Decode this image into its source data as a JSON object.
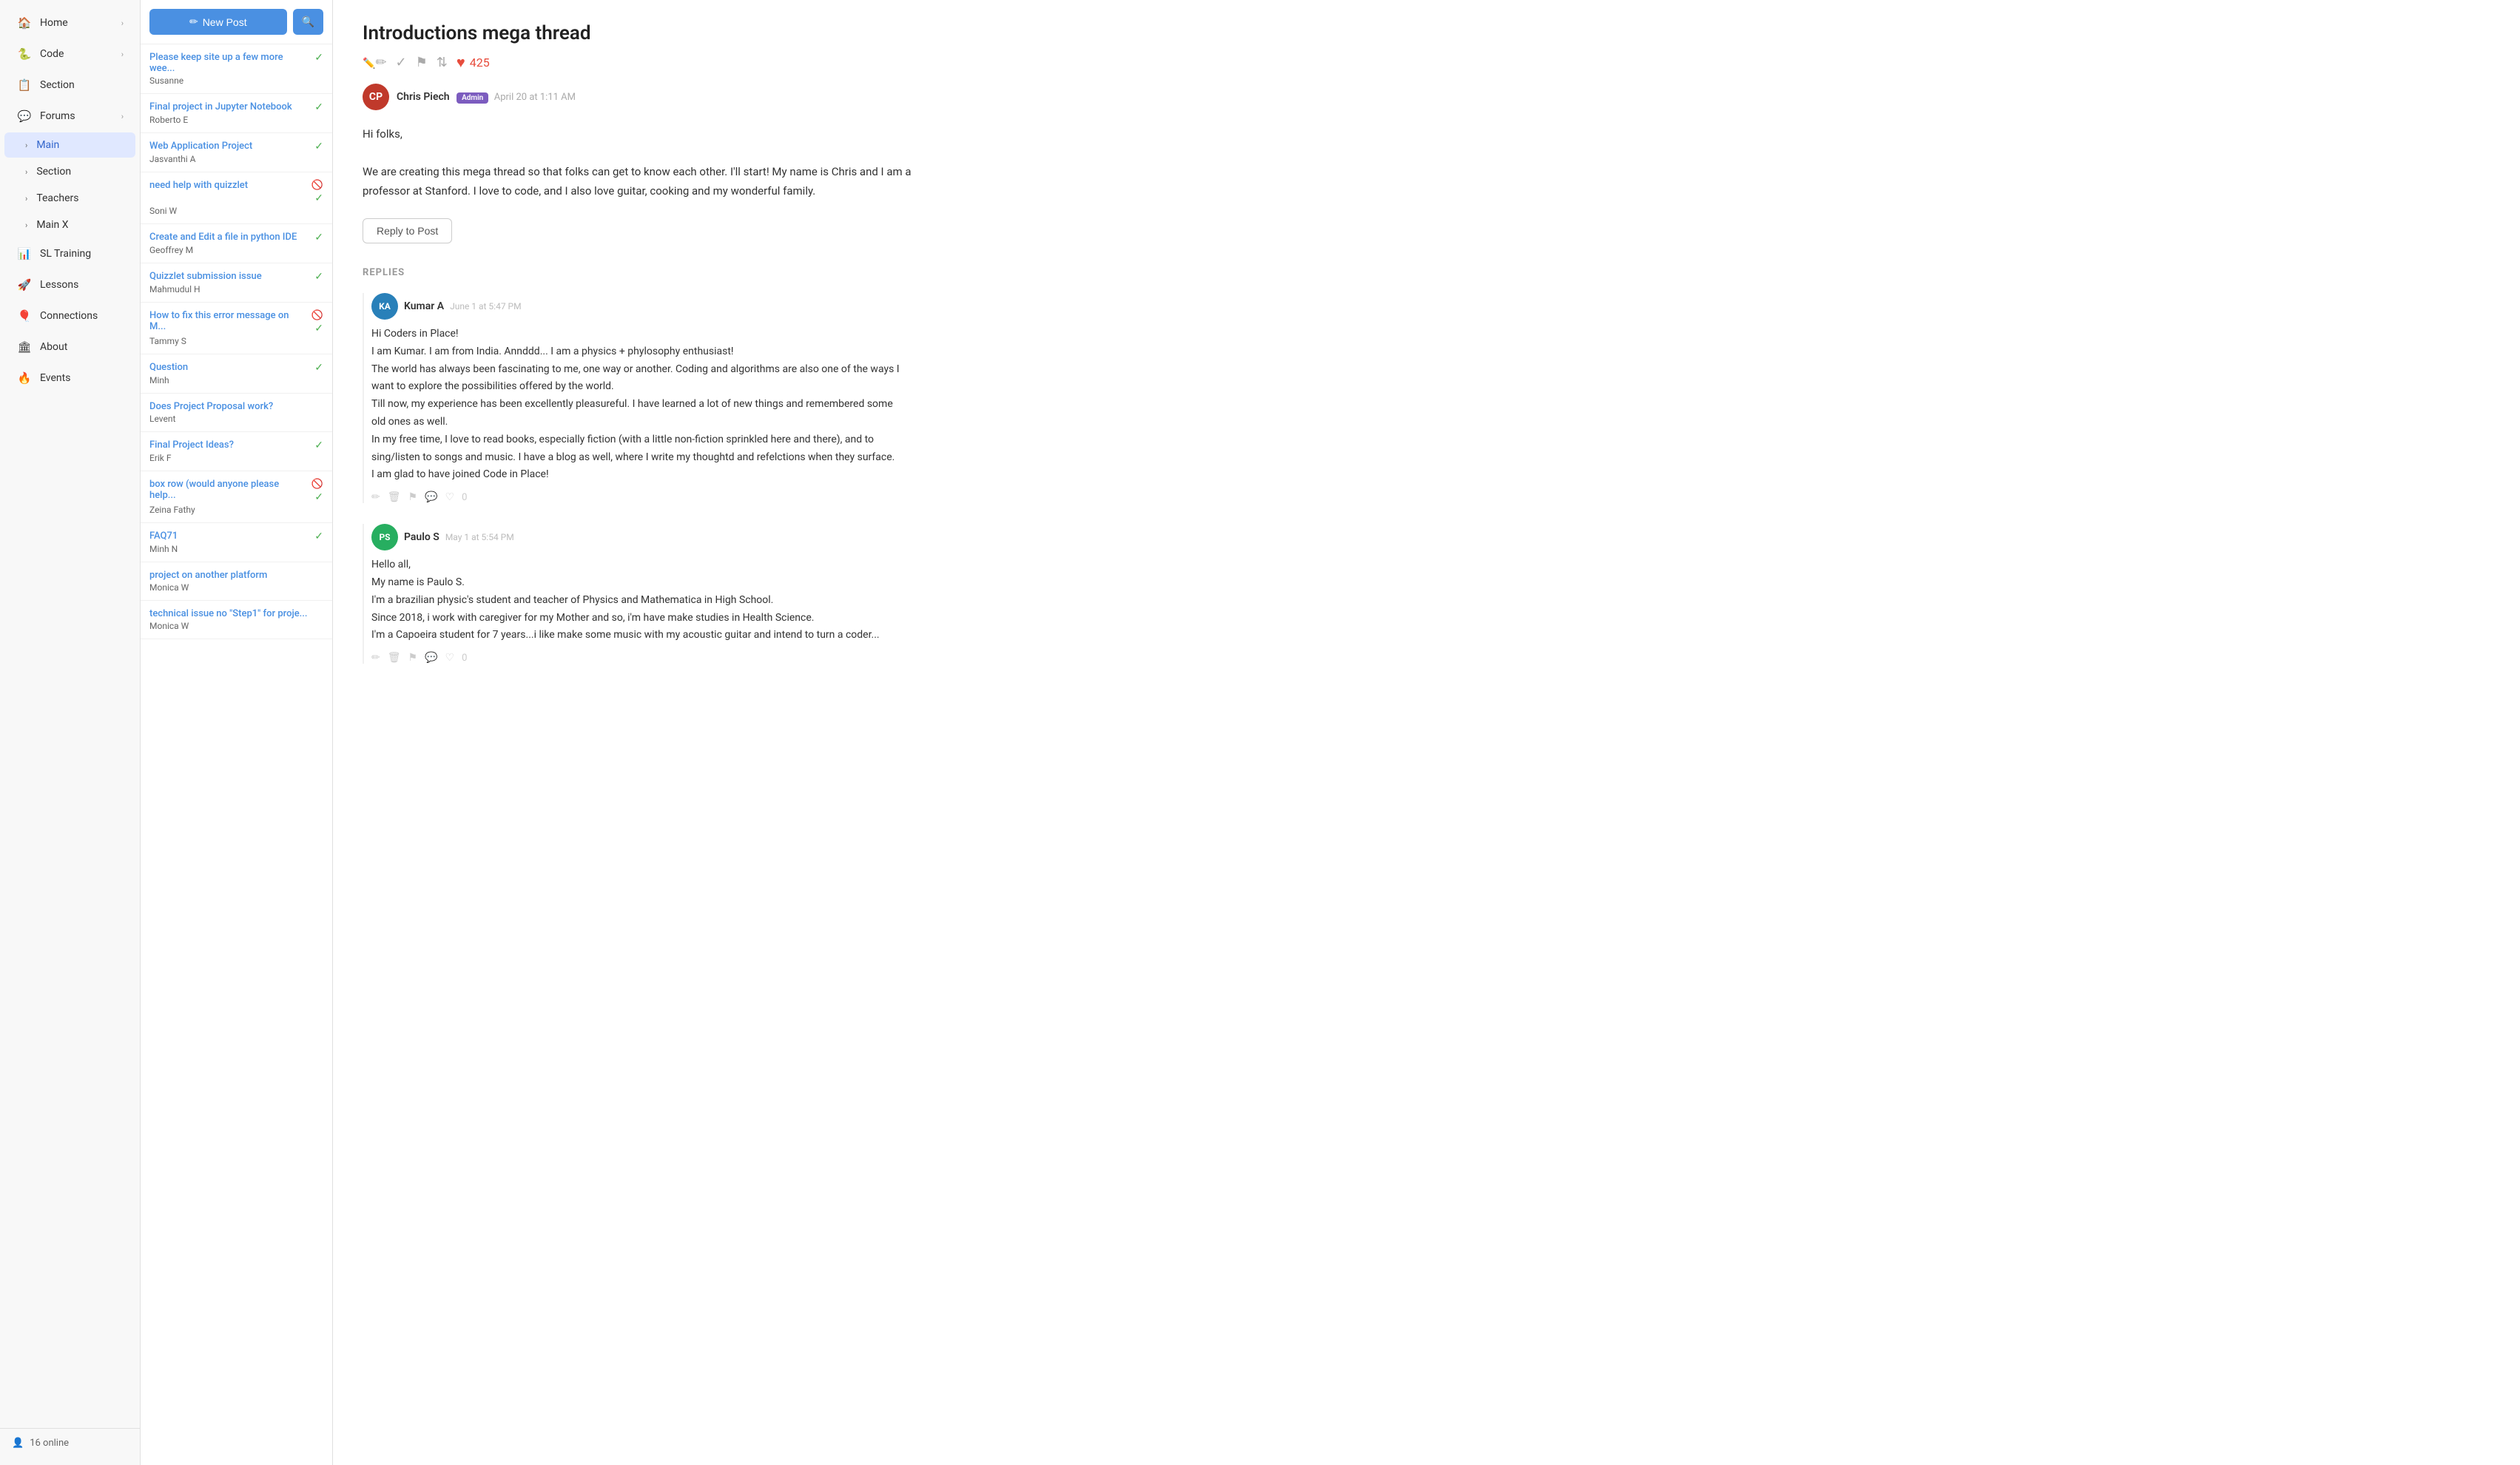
{
  "sidebar": {
    "items": [
      {
        "id": "home",
        "label": "Home",
        "icon": "icon-home",
        "chevron": "›",
        "active": false,
        "indent": false
      },
      {
        "id": "code",
        "label": "Code",
        "icon": "icon-code",
        "chevron": "›",
        "active": false,
        "indent": false
      },
      {
        "id": "section",
        "label": "Section",
        "icon": "icon-section",
        "chevron": "",
        "active": false,
        "indent": false
      },
      {
        "id": "forums",
        "label": "Forums",
        "icon": "icon-forums",
        "chevron": "›",
        "active": false,
        "indent": false
      },
      {
        "id": "main",
        "label": "Main",
        "icon": "",
        "chevron": "",
        "active": true,
        "indent": true,
        "arrow": "›"
      },
      {
        "id": "section2",
        "label": "Section",
        "icon": "",
        "chevron": "",
        "active": false,
        "indent": true,
        "arrow": "›"
      },
      {
        "id": "teachers",
        "label": "Teachers",
        "icon": "",
        "chevron": "",
        "active": false,
        "indent": true,
        "arrow": "›"
      },
      {
        "id": "mainx",
        "label": "Main X",
        "icon": "",
        "chevron": "",
        "active": false,
        "indent": true,
        "arrow": "›"
      },
      {
        "id": "sl-training",
        "label": "SL Training",
        "icon": "icon-sl",
        "chevron": "",
        "active": false,
        "indent": false
      },
      {
        "id": "lessons",
        "label": "Lessons",
        "icon": "icon-lessons",
        "chevron": "",
        "active": false,
        "indent": false
      },
      {
        "id": "connections",
        "label": "Connections",
        "icon": "icon-connections",
        "chevron": "",
        "active": false,
        "indent": false
      },
      {
        "id": "about",
        "label": "About",
        "icon": "icon-about",
        "chevron": "",
        "active": false,
        "indent": false
      },
      {
        "id": "events",
        "label": "Events",
        "icon": "icon-events",
        "chevron": "",
        "active": false,
        "indent": false
      }
    ],
    "online_count": "16 online"
  },
  "post_list": {
    "new_post_label": "New Post",
    "posts": [
      {
        "title": "Please keep site up a few more wee...",
        "author": "Susanne",
        "checked": true,
        "hidden": false
      },
      {
        "title": "Final project in Jupyter Notebook",
        "author": "Roberto E",
        "checked": true,
        "hidden": false
      },
      {
        "title": "Web Application Project",
        "author": "Jasvanthi A",
        "checked": true,
        "hidden": false
      },
      {
        "title": "need help with quizzlet",
        "author": "Soni W",
        "checked": true,
        "hidden": true
      },
      {
        "title": "Create and Edit a file in python IDE",
        "author": "Geoffrey M",
        "checked": true,
        "hidden": false
      },
      {
        "title": "Quizzlet submission issue",
        "author": "Mahmudul H",
        "checked": true,
        "hidden": false
      },
      {
        "title": "How to fix this error message on M...",
        "author": "Tammy S",
        "checked": true,
        "hidden": true
      },
      {
        "title": "Question",
        "author": "Minh",
        "checked": true,
        "hidden": false
      },
      {
        "title": "Does Project Proposal work?",
        "author": "Levent",
        "checked": false,
        "hidden": false
      },
      {
        "title": "Final Project Ideas?",
        "author": "Erik F",
        "checked": true,
        "hidden": false
      },
      {
        "title": "box row (would anyone please help...",
        "author": "Zeina Fathy",
        "checked": true,
        "hidden": true
      },
      {
        "title": "FAQ71",
        "author": "Minh N",
        "checked": true,
        "hidden": false
      },
      {
        "title": "project on another platform",
        "author": "Monica W",
        "checked": false,
        "hidden": false
      },
      {
        "title": "technical issue no \"Step1\" for proje...",
        "author": "Monica W",
        "checked": false,
        "hidden": false
      }
    ]
  },
  "thread": {
    "title": "Introductions mega thread",
    "heart_count": "425",
    "author": {
      "name": "Chris Piech",
      "badge": "Admin",
      "date": "April 20 at 1:11 AM",
      "avatar_initials": "CP"
    },
    "body": "Hi folks,\n\nWe are creating this mega thread so that folks can get to know each other. I'll start! My name is Chris and I am a professor at Stanford. I love to code, and I also love guitar, cooking and my wonderful family.",
    "reply_button_label": "Reply to Post",
    "replies_header": "REPLIES",
    "replies": [
      {
        "author": "Kumar A",
        "date": "June 1 at 5:47 PM",
        "body": "Hi Coders in Place!\nI am Kumar. I am from India. Annddd... I am a physics + phylosophy enthusiast!\nThe world has always been fascinating to me, one way or another. Coding and algorithms are also one of the ways I want to explore the possibilities offered by the world.\nTill now, my experience has been excellently pleasureful. I have learned a lot of new things and remembered some old ones as well.\nIn my free time, I love to read books, especially fiction (with a little non-fiction sprinkled here and there), and to sing/listen to songs and music. I have a blog as well, where I write my thoughtd and refelctions when they surface.\nI am glad to have joined Code in Place!",
        "reply_count": "0",
        "avatar_initials": "KA"
      },
      {
        "author": "Paulo S",
        "date": "May 1 at 5:54 PM",
        "body": "Hello all,\nMy name is Paulo S.\nI'm a brazilian physic's student and teacher of Physics and Mathematica in High School.\nSince 2018, i work with caregiver for my Mother and so, i'm have make studies in Health Science.\nI'm a Capoeira student for 7 years...i like make some music with my acoustic guitar and intend to turn a coder...",
        "reply_count": "0",
        "avatar_initials": "PS"
      }
    ]
  }
}
